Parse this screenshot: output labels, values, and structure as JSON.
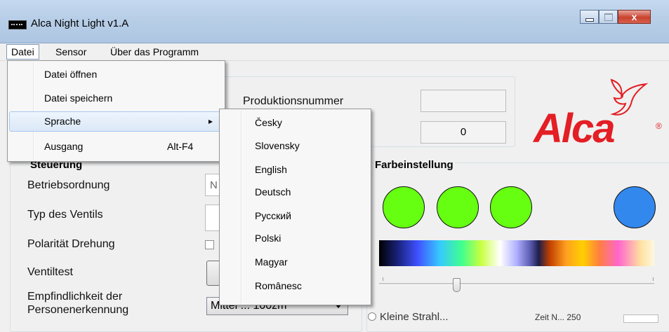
{
  "window": {
    "title": "Alca Night Light  v1.A",
    "close_label": "x"
  },
  "menubar": {
    "items": [
      "Datei",
      "Sensor",
      "Über das Programm"
    ]
  },
  "file_menu": {
    "items": [
      {
        "label": "Datei öffnen",
        "shortcut": ""
      },
      {
        "label": "Datei speichern",
        "shortcut": ""
      },
      {
        "label": "Sprache",
        "shortcut": "▸"
      },
      {
        "label": "Ausgang",
        "shortcut": "Alt-F4"
      }
    ]
  },
  "language_menu": {
    "items": [
      "Česky",
      "Slovensky",
      "English",
      "Deutsch",
      "Русский",
      "Polski",
      "Magyar",
      "Românesc"
    ]
  },
  "info": {
    "production_number_label": "Produktionsnummer",
    "production_number_value": "",
    "counter_value": "0"
  },
  "logo": {
    "text": "Alca",
    "registered": "®",
    "brand_color": "#e31e24"
  },
  "control": {
    "section_title": "Steuerung",
    "operating_mode_label": "Betriebsordnung",
    "operating_mode_value": "N",
    "valve_type_label": "Typ des Ventils",
    "polarity_label": "Polarität Drehung",
    "valve_test_label": "Ventiltest",
    "sensitivity_label_line1": "Empfindlichkeit der",
    "sensitivity_label_line2": "Personenerkennung",
    "sensitivity_value": "Mittel  ... 100zm"
  },
  "color": {
    "section_title": "Farbeinstellung",
    "swatches": [
      "#66ff11",
      "#66ff11",
      "#66ff11",
      "#3388ee"
    ],
    "slider_value": 0.28,
    "bottom_left_partial": "Kleine Strahl...",
    "bottom_right_partial": "Zeit N... 250"
  }
}
